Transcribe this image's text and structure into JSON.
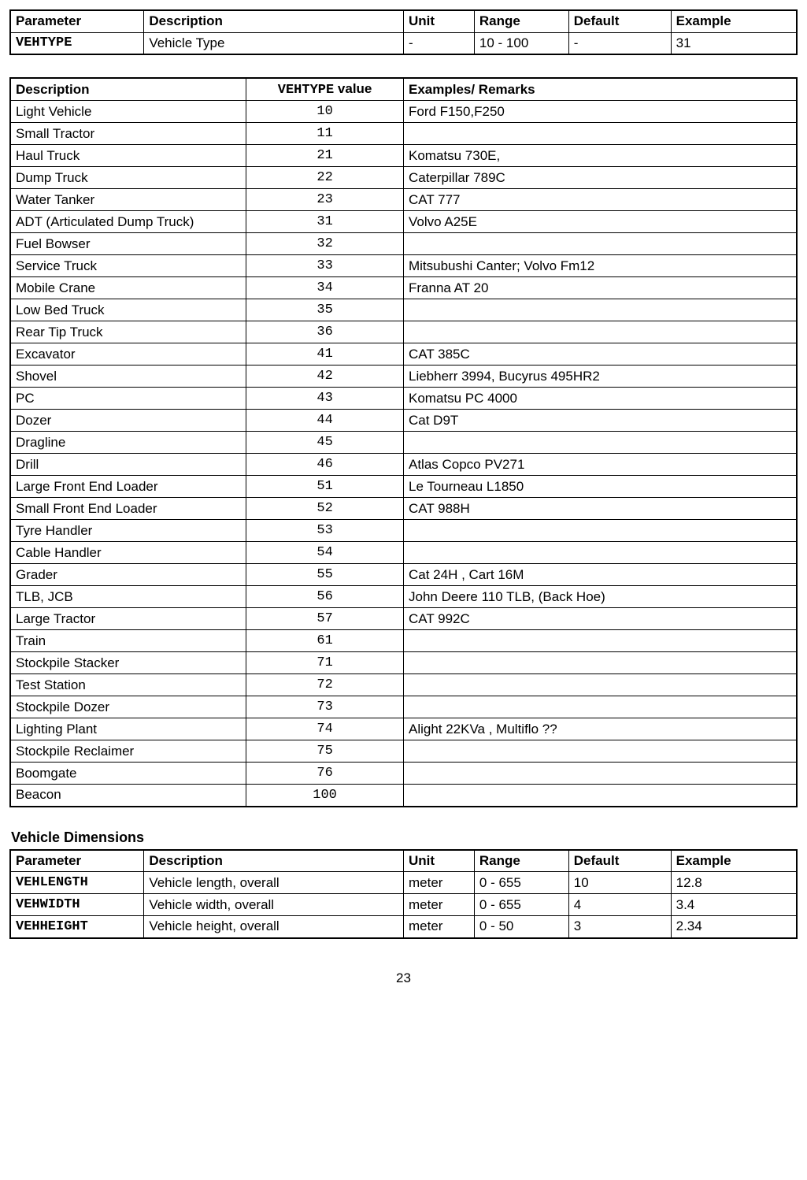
{
  "table1": {
    "headers": [
      "Parameter",
      "Description",
      "Unit",
      "Range",
      "Default",
      "Example"
    ],
    "row": {
      "param": "VEHTYPE",
      "desc": "Vehicle Type",
      "unit": "-",
      "range": "10 - 100",
      "default": "-",
      "example": "31"
    }
  },
  "table2": {
    "headers": {
      "h1": "Description",
      "h2a": "VEHTYPE",
      "h2b": " value",
      "h3": "Examples/ Remarks"
    },
    "rows": [
      {
        "d": "Light  Vehicle",
        "v": "10",
        "e": "Ford F150,F250"
      },
      {
        "d": "Small  Tractor",
        "v": "11",
        "e": ""
      },
      {
        "d": "Haul Truck",
        "v": "21",
        "e": "Komatsu 730E,"
      },
      {
        "d": "Dump Truck",
        "v": "22",
        "e": "Caterpillar 789C"
      },
      {
        "d": "Water Tanker",
        "v": "23",
        "e": "CAT 777"
      },
      {
        "d": "ADT (Articulated Dump Truck)",
        "v": "31",
        "e": "Volvo A25E"
      },
      {
        "d": "Fuel Bowser",
        "v": "32",
        "e": ""
      },
      {
        "d": "Service Truck",
        "v": "33",
        "e": "Mitsubushi Canter; Volvo Fm12"
      },
      {
        "d": "Mobile Crane",
        "v": "34",
        "e": "Franna AT 20"
      },
      {
        "d": "Low Bed Truck",
        "v": "35",
        "e": ""
      },
      {
        "d": "Rear Tip Truck",
        "v": "36",
        "e": ""
      },
      {
        "d": "Excavator",
        "v": "41",
        "e": "CAT 385C"
      },
      {
        "d": "Shovel",
        "v": "42",
        "e": "Liebherr 3994, Bucyrus 495HR2"
      },
      {
        "d": "PC",
        "v": "43",
        "e": "Komatsu PC 4000"
      },
      {
        "d": "Dozer",
        "v": "44",
        "e": "Cat D9T"
      },
      {
        "d": "Dragline",
        "v": "45",
        "e": ""
      },
      {
        "d": "Drill",
        "v": "46",
        "e": "Atlas Copco PV271"
      },
      {
        "d": "Large Front End Loader",
        "v": "51",
        "e": "Le Tourneau L1850"
      },
      {
        "d": "Small Front End Loader",
        "v": "52",
        "e": "CAT 988H"
      },
      {
        "d": "Tyre Handler",
        "v": "53",
        "e": ""
      },
      {
        "d": "Cable Handler",
        "v": "54",
        "e": ""
      },
      {
        "d": "Grader",
        "v": "55",
        "e": "Cat 24H , Cart 16M"
      },
      {
        "d": "TLB, JCB",
        "v": "56",
        "e": "John Deere 110 TLB, (Back Hoe)"
      },
      {
        "d": "Large Tractor",
        "v": "57",
        "e": "CAT 992C"
      },
      {
        "d": "Train",
        "v": "61",
        "e": ""
      },
      {
        "d": "Stockpile Stacker",
        "v": "71",
        "e": ""
      },
      {
        "d": "Test Station",
        "v": "72",
        "e": ""
      },
      {
        "d": "Stockpile Dozer",
        "v": "73",
        "e": ""
      },
      {
        "d": "Lighting Plant",
        "v": "74",
        "e": "Alight 22KVa , Multiflo ??"
      },
      {
        "d": "Stockpile Reclaimer",
        "v": "75",
        "e": ""
      },
      {
        "d": "Boomgate",
        "v": "76",
        "e": ""
      },
      {
        "d": "Beacon",
        "v": "100",
        "e": ""
      }
    ]
  },
  "section3_title": "Vehicle Dimensions",
  "table3": {
    "headers": [
      "Parameter",
      "Description",
      "Unit",
      "Range",
      "Default",
      "Example"
    ],
    "rows": [
      {
        "p": "VEHLENGTH",
        "d": "Vehicle length, overall",
        "u": "meter",
        "r": "0 - 655",
        "def": "10",
        "ex": "12.8"
      },
      {
        "p": "VEHWIDTH",
        "d": "Vehicle width, overall",
        "u": "meter",
        "r": "0 - 655",
        "def": "4",
        "ex": "3.4"
      },
      {
        "p": "VEHHEIGHT",
        "d": "Vehicle height, overall",
        "u": "meter",
        "r": "0 - 50",
        "def": "3",
        "ex": "2.34"
      }
    ]
  },
  "page_number": "23"
}
